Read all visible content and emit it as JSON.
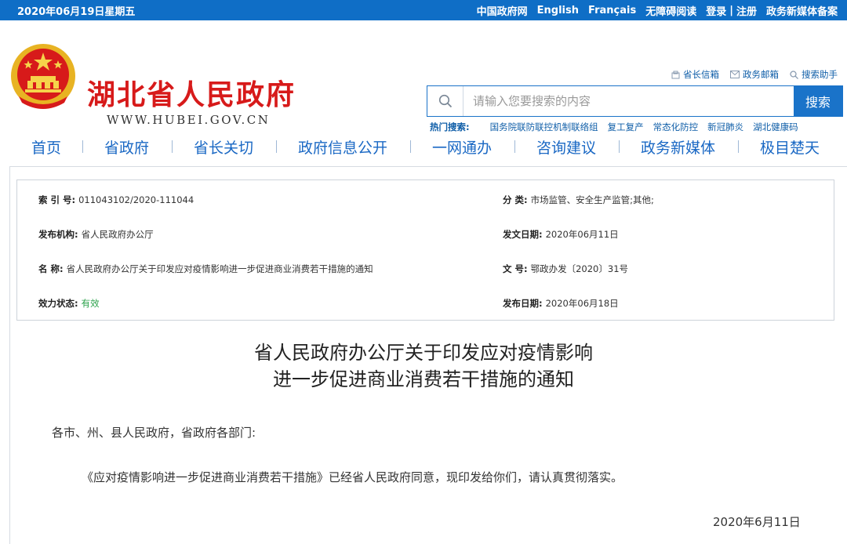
{
  "topbar": {
    "date": "2020年06月19日星期五",
    "links": [
      "中国政府网",
      "English",
      "Français",
      "无障碍阅读"
    ],
    "login": "登录",
    "register": "注册",
    "media": "政务新媒体备案"
  },
  "header": {
    "title": "湖北省人民政府",
    "url": "WWW.HUBEI.GOV.CN",
    "tools": [
      "省长信箱",
      "政务邮箱",
      "搜索助手"
    ]
  },
  "search": {
    "placeholder": "请输入您要搜索的内容",
    "button": "搜索",
    "hot_label": "热门搜索:",
    "hot": [
      "国务院联防联控机制联络组",
      "复工复产",
      "常态化防控",
      "新冠肺炎",
      "湖北健康码"
    ]
  },
  "nav": [
    "首页",
    "省政府",
    "省长关切",
    "政府信息公开",
    "一网通办",
    "咨询建议",
    "政务新媒体",
    "极目楚天"
  ],
  "meta": {
    "index_k": "索 引 号:",
    "index_v": "011043102/2020-111044",
    "cat_k": "分 类:",
    "cat_v": "市场监管、安全生产监管;其他;",
    "org_k": "发布机构:",
    "org_v": "省人民政府办公厅",
    "issue_k": "发文日期:",
    "issue_v": "2020年06月11日",
    "name_k": "名 称:",
    "name_v": "省人民政府办公厅关于印发应对疫情影响进一步促进商业消费若干措施的通知",
    "num_k": "文 号:",
    "num_v": "鄂政办发〔2020〕31号",
    "status_k": "效力状态:",
    "status_v": "有效",
    "pub_k": "发布日期:",
    "pub_v": "2020年06月18日"
  },
  "doc": {
    "title_line1": "省人民政府办公厅关于印发应对疫情影响",
    "title_line2": "进一步促进商业消费若干措施的通知",
    "salutation": "各市、州、县人民政府，省政府各部门:",
    "body": "《应对疫情影响进一步促进商业消费若干措施》已经省人民政府同意，现印发给你们，请认真贯彻落实。",
    "date": "2020年6月11日"
  },
  "colors": {
    "topbar": "#0f6ec6",
    "title_red": "#d71a1a",
    "nav_blue": "#1a68c4",
    "valid_green": "#2aa14a"
  }
}
